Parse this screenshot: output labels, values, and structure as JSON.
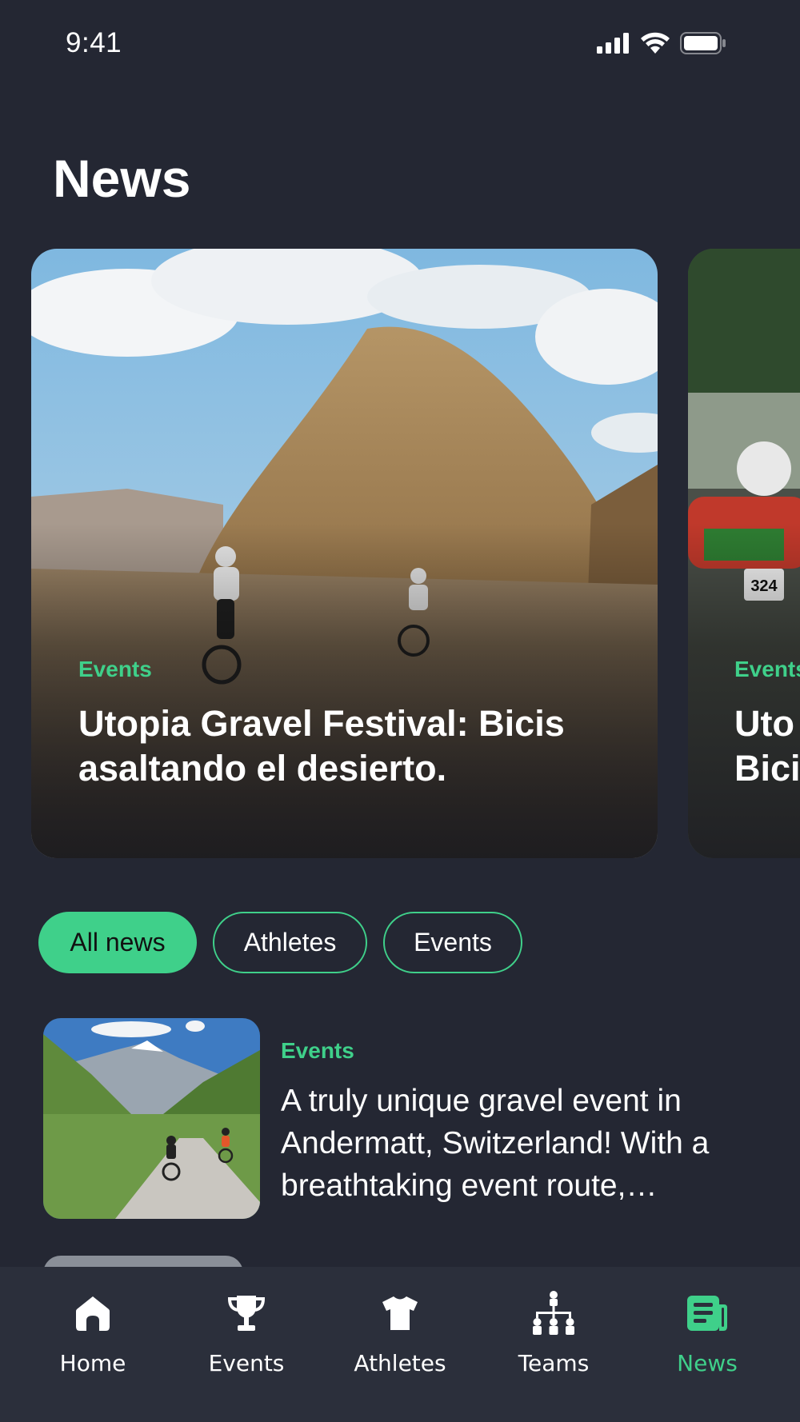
{
  "status_bar": {
    "time": "9:41"
  },
  "header": {
    "title": "News"
  },
  "featured": [
    {
      "category": "Events",
      "title": "Utopia Gravel Festival: Bicis asaltando el desierto."
    },
    {
      "category": "Events",
      "title_line_1": "Uto",
      "title_line_2": "Bici",
      "bib_number": "324"
    }
  ],
  "filters": [
    {
      "label": "All news",
      "active": true
    },
    {
      "label": "Athletes",
      "active": false
    },
    {
      "label": "Events",
      "active": false
    }
  ],
  "news_list": [
    {
      "category": "Events",
      "text": "A truly unique gravel event in Andermatt, Switzerland! With a breathtaking event route,…"
    }
  ],
  "tab_bar": [
    {
      "label": "Home",
      "icon": "home-icon",
      "active": false
    },
    {
      "label": "Events",
      "icon": "trophy-icon",
      "active": false
    },
    {
      "label": "Athletes",
      "icon": "jersey-icon",
      "active": false
    },
    {
      "label": "Teams",
      "icon": "hierarchy-icon",
      "active": false
    },
    {
      "label": "News",
      "icon": "newspaper-icon",
      "active": true
    }
  ],
  "colors": {
    "background": "#242733",
    "accent": "#3fd08a",
    "tab_bar": "#2b2f3b"
  }
}
